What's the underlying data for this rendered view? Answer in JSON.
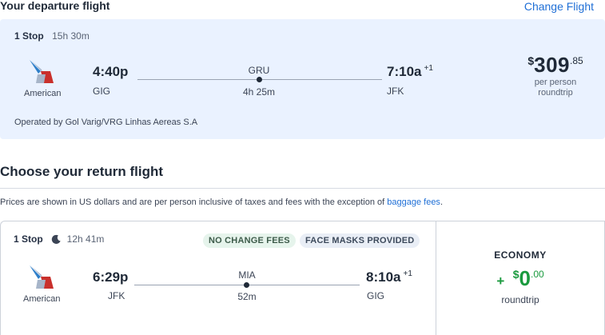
{
  "departure": {
    "heading": "Your departure flight",
    "change_link": "Change Flight",
    "stops": "1 Stop",
    "duration": "15h 30m",
    "airline": "American",
    "depart_time": "4:40p",
    "depart_code": "GIG",
    "layover_code": "GRU",
    "layover_duration": "4h 25m",
    "arrive_time": "7:10a",
    "arrive_day_offset": "+1",
    "arrive_code": "JFK",
    "price_symbol": "$",
    "price_dollars": "309",
    "price_cents": ".85",
    "price_line1": "per person",
    "price_line2": "roundtrip",
    "operated_by": "Operated by Gol Varig/VRG Linhas Aereas S.A"
  },
  "return_section": {
    "heading": "Choose your return flight",
    "note_text": "Prices are shown in US dollars and are per person inclusive of taxes and fees with the exception of ",
    "note_link": "baggage fees",
    "note_end": "."
  },
  "return_flight": {
    "stops": "1 Stop",
    "duration": "12h 41m",
    "badge1": "NO CHANGE FEES",
    "badge2": "FACE MASKS PROVIDED",
    "airline": "American",
    "depart_time": "6:29p",
    "depart_code": "JFK",
    "layover_code": "MIA",
    "layover_duration": "52m",
    "arrive_time": "8:10a",
    "arrive_day_offset": "+1",
    "arrive_code": "GIG",
    "cabin": "ECONOMY",
    "price_prefix": "+",
    "price_symbol": "$",
    "price_dollars": "0",
    "price_cents": ".00",
    "price_sub": "roundtrip"
  },
  "colors": {
    "accent_link": "#1f6fd6",
    "card_bg": "#eaf2ff",
    "price_green": "#1a9a3e"
  },
  "icons": {
    "airline_logo": "american-airlines-logo",
    "moon": "moon-icon"
  }
}
